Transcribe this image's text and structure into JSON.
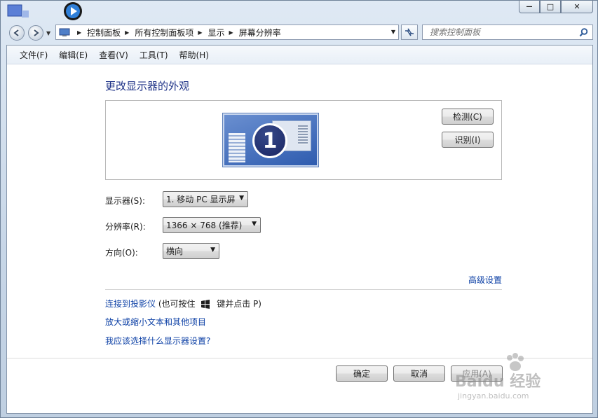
{
  "window": {
    "caption_minimize": "—",
    "caption_maximize": "□",
    "caption_close": "✕"
  },
  "address": {
    "crumbs": [
      "控制面板",
      "所有控制面板项",
      "显示",
      "屏幕分辨率"
    ]
  },
  "search": {
    "placeholder": "搜索控制面板"
  },
  "menu": [
    "文件(F)",
    "编辑(E)",
    "查看(V)",
    "工具(T)",
    "帮助(H)"
  ],
  "page": {
    "title": "更改显示器的外观",
    "monitor_number": "1",
    "detect_button": "检测(C)",
    "identify_button": "识别(I)"
  },
  "settings": {
    "display_label": "显示器(S):",
    "display_value": "1. 移动 PC 显示屏",
    "resolution_label": "分辨率(R):",
    "resolution_value": "1366 × 768 (推荐)",
    "orientation_label": "方向(O):",
    "orientation_value": "横向",
    "advanced_link": "高级设置"
  },
  "links": {
    "projector_link": "连接到投影仪",
    "projector_hint_prefix": "(也可按住",
    "projector_hint_suffix": "键并点击 P)",
    "text_size_link": "放大或缩小文本和其他项目",
    "which_settings_link": "我应该选择什么显示器设置?"
  },
  "footer": {
    "ok_button": "确定",
    "cancel_button": "取消",
    "apply_button": "应用(A)"
  },
  "watermark": {
    "brand": "Baidu 经验",
    "url": "jingyan.baidu.com"
  },
  "colors": {
    "link": "#0b3fa5",
    "title": "#1e3287",
    "window_frame": "#c7d6e7"
  }
}
